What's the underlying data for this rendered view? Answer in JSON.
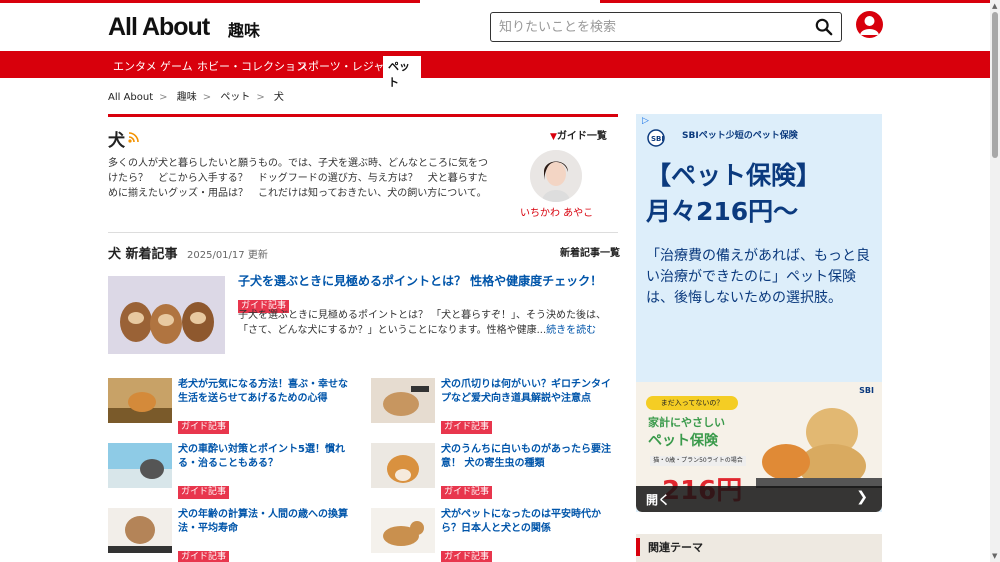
{
  "header": {
    "logo_text": "All About",
    "category": "趣味",
    "search_placeholder": "知りたいことを検索"
  },
  "nav": {
    "tabs": [
      {
        "label": "エンタメ"
      },
      {
        "label": "ゲーム"
      },
      {
        "label": "ホビー・コレクション"
      },
      {
        "label": "スポーツ・レジャー"
      },
      {
        "label": "ペット",
        "active": true
      }
    ]
  },
  "breadcrumb": [
    "All About",
    "趣味",
    "ペット",
    "犬"
  ],
  "topic": {
    "title": "犬",
    "guide_list_label": "ガイド一覧",
    "description": "多くの人が犬と暮らしたいと願うもの。では、子犬を選ぶ時、どんなところに気をつけたら？　どこから入手する？　ドッグフードの選び方、与え方は？　犬と暮らすために揃えたいグッズ・用品は？　これだけは知っておきたい、犬の飼い方について。",
    "guide_name": "いちかわ あやこ"
  },
  "new_articles": {
    "title": "犬 新着記事",
    "date": "2025/01/17 更新",
    "list_label": "新着記事一覧"
  },
  "featured": {
    "title": "子犬を選ぶときに見極めるポイントとは？ 性格や健康度チェック！",
    "badge": "ガイド記事",
    "text": "子犬を選ぶときに見極めるポイントとは？ 「犬と暮らすぞ！」、そう決めた後は、「さて、どんな犬にするか？」ということになります。性格や健康...",
    "more": "続きを読む"
  },
  "articles": [
    {
      "title": "老犬が元気になる方法！喜ぶ・幸せな生活を送らせてあげるための心得",
      "badge": "ガイド記事"
    },
    {
      "title": "犬の爪切りは何がいい？ギロチンタイプなど爱犬向き道具解説や注意点",
      "badge": "ガイド記事"
    },
    {
      "title": "犬の車酔い対策とポイント5選！慣れる・治ることもある？",
      "badge": "ガイド記事"
    },
    {
      "title": "犬のうんちに白いものがあったら要注意！ 犬の寄生虫の種類",
      "badge": "ガイド記事"
    },
    {
      "title": "犬の年齢の計算法・人間の歳への換算法・平均寿命",
      "badge": "ガイド記事"
    },
    {
      "title": "犬がペットになったのは平安時代から？日本人と犬との関係",
      "badge": "ガイド記事"
    }
  ],
  "ad": {
    "brand": "SBIペット少短のペット保険",
    "headline_1": "【ペット保険】",
    "headline_2": "月々216円〜",
    "body": "「治療費の備えがあれば、もっと良い治療ができたのに」ペット保険は、後悔しないための選択肢。",
    "banner_bubble": "まだ入ってないの？",
    "banner_line1": "家計にやさしい",
    "banner_line2": "ペット保険",
    "banner_line3": "猫・0歳・プラン50ライトの場合",
    "banner_price": "216円",
    "banner_brand": "SBI",
    "open_label": "開く",
    "next_label": "❯"
  },
  "related": {
    "title": "関連テーマ"
  },
  "colors": {
    "brand_red": "#d8000c",
    "link_blue": "#0055aa",
    "badge_pink": "#e8364d",
    "ad_navy": "#0b3a7e"
  }
}
